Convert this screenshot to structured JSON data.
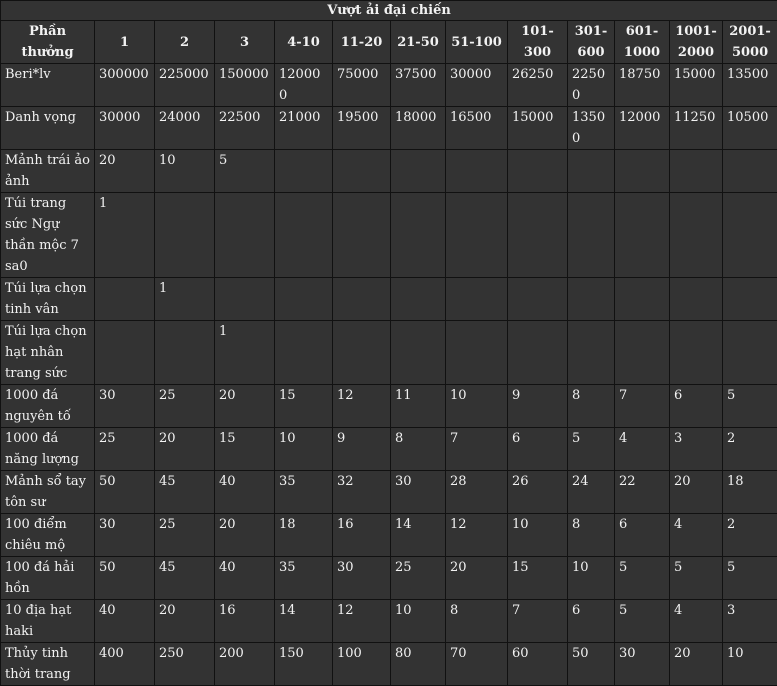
{
  "title": "Vượt ải đại chiến",
  "headers": [
    "Phần thưởng",
    "1",
    "2",
    "3",
    "4-10",
    "11-20",
    "21-50",
    "51-100",
    "101-300",
    "301-600",
    "601-1000",
    "1001-2000",
    "2001-5000"
  ],
  "rows": [
    {
      "name": "Beri*lv",
      "values": [
        "300000",
        "225000",
        "150000",
        "120000",
        "75000",
        "37500",
        "30000",
        "26250",
        "22500",
        "18750",
        "15000",
        "13500"
      ]
    },
    {
      "name": "Danh vọng",
      "values": [
        "30000",
        "24000",
        "22500",
        "21000",
        "19500",
        "18000",
        "16500",
        "15000",
        "13500",
        "12000",
        "11250",
        "10500"
      ]
    },
    {
      "name": "Mảnh trái ảo ảnh",
      "values": [
        "20",
        "10",
        "5",
        "",
        "",
        "",
        "",
        "",
        "",
        "",
        "",
        ""
      ]
    },
    {
      "name": "Túi trang sức Ngự thần mộc 7 sa0",
      "values": [
        "1",
        "",
        "",
        "",
        "",
        "",
        "",
        "",
        "",
        "",
        "",
        ""
      ]
    },
    {
      "name": "Túi lựa chọn tinh vân",
      "values": [
        "",
        "1",
        "",
        "",
        "",
        "",
        "",
        "",
        "",
        "",
        "",
        ""
      ]
    },
    {
      "name": "Túi lựa chọn hạt nhân trang sức",
      "values": [
        "",
        "",
        "1",
        "",
        "",
        "",
        "",
        "",
        "",
        "",
        "",
        ""
      ]
    },
    {
      "name": "1000 đá nguyên tố",
      "values": [
        "30",
        "25",
        "20",
        "15",
        "12",
        "11",
        "10",
        "9",
        "8",
        "7",
        "6",
        "5"
      ]
    },
    {
      "name": "1000 đá năng lượng",
      "values": [
        "25",
        "20",
        "15",
        "10",
        "9",
        "8",
        "7",
        "6",
        "5",
        "4",
        "3",
        "2"
      ]
    },
    {
      "name": "Mảnh sổ tay tôn sư",
      "values": [
        "50",
        "45",
        "40",
        "35",
        "32",
        "30",
        "28",
        "26",
        "24",
        "22",
        "20",
        "18"
      ]
    },
    {
      "name": "100 điểm chiêu mộ",
      "values": [
        "30",
        "25",
        "20",
        "18",
        "16",
        "14",
        "12",
        "10",
        "8",
        "6",
        "4",
        "2"
      ]
    },
    {
      "name": "100 đá hải hồn",
      "values": [
        "50",
        "45",
        "40",
        "35",
        "30",
        "25",
        "20",
        "15",
        "10",
        "5",
        "5",
        "5"
      ]
    },
    {
      "name": "10 địa hạt haki",
      "values": [
        "40",
        "20",
        "16",
        "14",
        "12",
        "10",
        "8",
        "7",
        "6",
        "5",
        "4",
        "3"
      ]
    },
    {
      "name": "Thủy tinh thời trang",
      "values": [
        "400",
        "250",
        "200",
        "150",
        "100",
        "80",
        "70",
        "60",
        "50",
        "30",
        "20",
        "10"
      ]
    }
  ]
}
